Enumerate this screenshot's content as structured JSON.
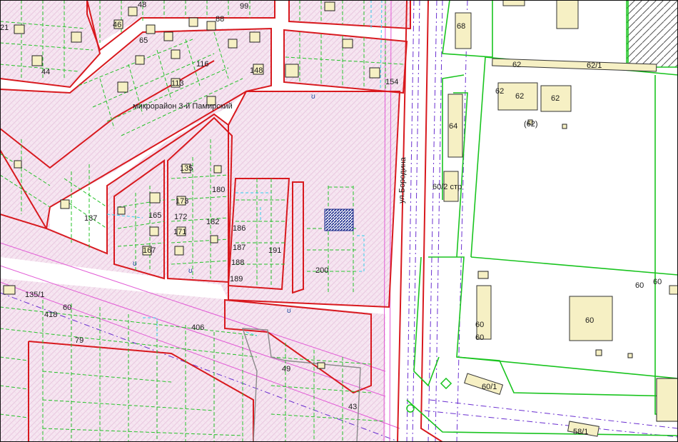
{
  "map": {
    "street_label": "ул.Бородина",
    "district_label": "микрорайон 3-й Памирский",
    "lot_labels": {
      "l48": "48",
      "l99": "99",
      "l88": "88",
      "l21": "21",
      "l46": "46",
      "l65": "65",
      "l68": "68",
      "l44": "44",
      "l116": "116",
      "l148": "148",
      "l154": "154",
      "l113": "113",
      "l62a": "62",
      "l621": "62/1",
      "l62b": "62",
      "l62c": "62",
      "l62d": "62",
      "l62p": "(62)",
      "l64": "64",
      "l135": "135",
      "l180": "180",
      "l137": "137",
      "l165": "165",
      "l173": "173",
      "l172": "172",
      "l182": "182",
      "l171": "171",
      "l186": "186",
      "l167": "167",
      "l187": "187",
      "l191": "191",
      "l188": "188",
      "l189": "189",
      "l200": "200",
      "l602": "60/2 стр",
      "l1351": "135/1",
      "l60a": "60",
      "l60b": "60",
      "l60c": "60",
      "l60d": "60",
      "l60e": "60",
      "l60f": "60",
      "l418": "418",
      "l406": "406",
      "l79": "79",
      "l43": "43",
      "l49": "49",
      "l601": "60/1",
      "l581": "58/1"
    },
    "colors": {
      "background_fill": "#f6e6f1",
      "red_boundary": "#d8191e",
      "green_boundary": "#19c41f",
      "cyan_line": "#35d2ee",
      "purple_line": "#6a2fd0",
      "hatch_blue": "#1b2a8c",
      "building_fill": "#f6f0c4"
    }
  }
}
